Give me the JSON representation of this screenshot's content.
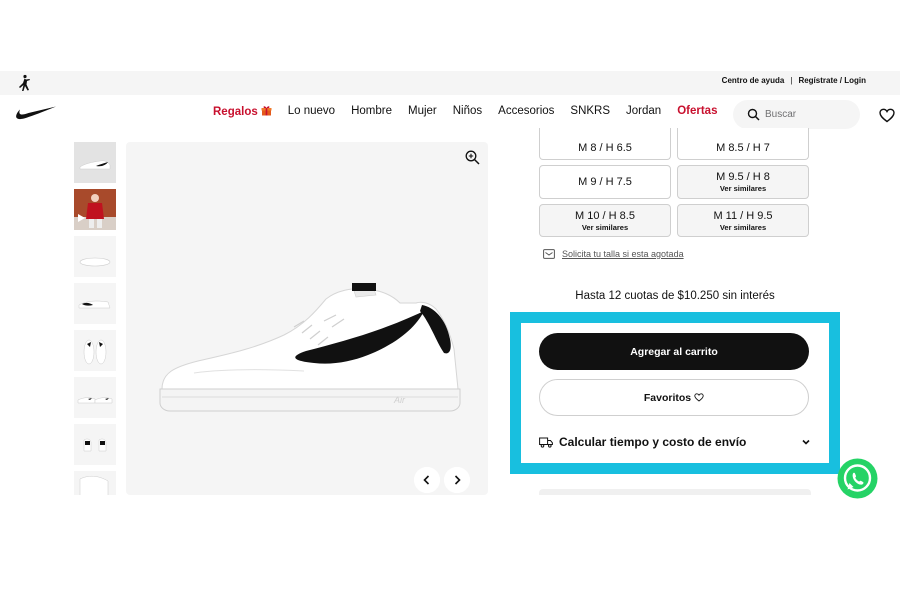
{
  "top_bar": {
    "help_link": "Centro de ayuda",
    "separator": "|",
    "login_link": "Regístrate / Login"
  },
  "nav": {
    "items": [
      {
        "label": "Regalos",
        "highlight": true,
        "icon": "gift-icon"
      },
      {
        "label": "Lo nuevo"
      },
      {
        "label": "Hombre"
      },
      {
        "label": "Mujer"
      },
      {
        "label": "Niños"
      },
      {
        "label": "Accesorios"
      },
      {
        "label": "SNKRS"
      },
      {
        "label": "Jordan"
      },
      {
        "label": "Ofertas",
        "highlight": true
      }
    ],
    "search_placeholder": "Buscar"
  },
  "sizes": [
    {
      "label": "M 8 / H 6.5",
      "sub": ""
    },
    {
      "label": "M 8.5 / H 7",
      "sub": ""
    },
    {
      "label": "M 9 / H 7.5",
      "sub": ""
    },
    {
      "label": "M 9.5 / H 8",
      "sub": "Ver similares"
    },
    {
      "label": "M 10 / H 8.5",
      "sub": "Ver similares"
    },
    {
      "label": "M 11 / H 9.5",
      "sub": "Ver similares"
    }
  ],
  "notify_text": "Solicita tu talla si esta agotada",
  "installments": "Hasta 12 cuotas de $10.250 sin interés",
  "actions": {
    "cart": "Agregar al carrito",
    "favorites": "Favoritos",
    "shipping": "Calcular tiempo y costo de envío"
  },
  "colors": {
    "accent_red": "#c8102e",
    "highlight_border": "#18bfdf",
    "primary_button": "#111111",
    "whatsapp": "#25d366"
  }
}
